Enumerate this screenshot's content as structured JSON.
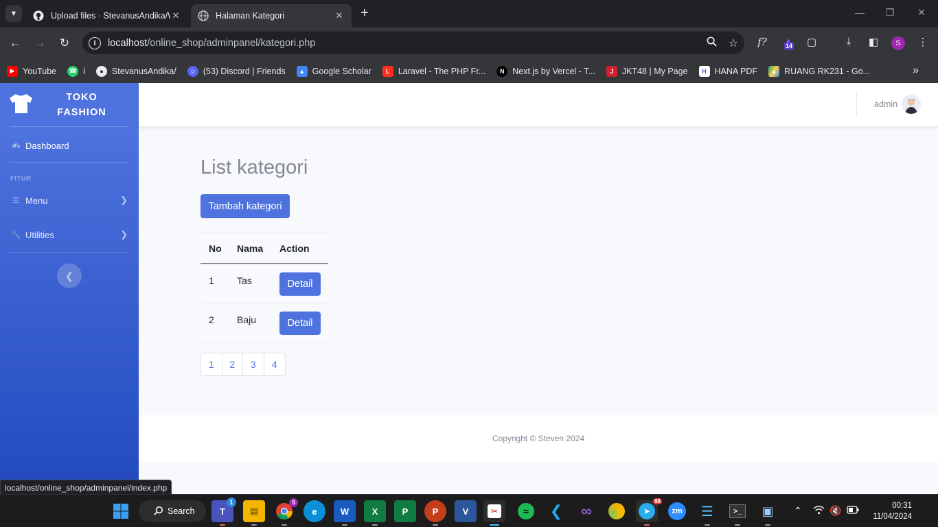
{
  "browser": {
    "tabs": [
      {
        "title": "Upload files · StevanusAndika/W",
        "active": false,
        "icon": "github-icon"
      },
      {
        "title": "Halaman Kategori",
        "active": true,
        "icon": "globe-icon"
      }
    ],
    "url_host": "localhost",
    "url_path": "/online_shop/adminpanel/kategori.php",
    "extension_badge": "14",
    "profile_initial": "S",
    "bookmarks": [
      {
        "label": "YouTube",
        "icon": "youtube-icon",
        "color": "#ff0000"
      },
      {
        "label": "i",
        "icon": "whatsapp-icon",
        "color": "#25d366"
      },
      {
        "label": "StevanusAndika/",
        "icon": "github-icon",
        "color": "#e8eaed"
      },
      {
        "label": "(53) Discord | Friends",
        "icon": "discord-icon",
        "color": "#5865f2"
      },
      {
        "label": "Google Scholar",
        "icon": "scholar-icon",
        "color": "#4285f4"
      },
      {
        "label": "Laravel - The PHP Fr...",
        "icon": "laravel-icon",
        "color": "#ff2d20"
      },
      {
        "label": "Next.js by Vercel - T...",
        "icon": "nextjs-icon",
        "color": "#000000"
      },
      {
        "label": "JKT48 | My Page",
        "icon": "jkt48-icon",
        "color": "#d1202f"
      },
      {
        "label": "HANA PDF",
        "icon": "hana-icon",
        "color": "#ffffff"
      },
      {
        "label": "RUANG RK231 - Go...",
        "icon": "drive-icon",
        "color": "#1fa463"
      }
    ],
    "status_url": "localhost/online_shop/adminpanel/index.php"
  },
  "sidebar": {
    "brand_line1": "TOKO",
    "brand_line2": "FASHION",
    "dashboard": "Dashboard",
    "heading": "FITUR",
    "menu": "Menu",
    "utilities": "Utilities"
  },
  "topbar": {
    "username": "admin"
  },
  "main": {
    "title": "List kategori",
    "add_button": "Tambah kategori",
    "table": {
      "headers": [
        "No",
        "Nama",
        "Action"
      ],
      "rows": [
        {
          "no": "1",
          "nama": "Tas",
          "action": "Detail"
        },
        {
          "no": "2",
          "nama": "Baju",
          "action": "Detail"
        }
      ]
    },
    "pagination": [
      "1",
      "2",
      "3",
      "4"
    ]
  },
  "footer": {
    "copyright": "Copyright © Steven 2024"
  },
  "taskbar": {
    "search_label": "Search",
    "teams_badge": "1",
    "chrome_badge": "S",
    "telegram_badge": "98",
    "time": "00:31",
    "date": "11/04/2024"
  },
  "colors": {
    "primary": "#4e73df",
    "sidebar_gradient_end": "#224abe"
  }
}
